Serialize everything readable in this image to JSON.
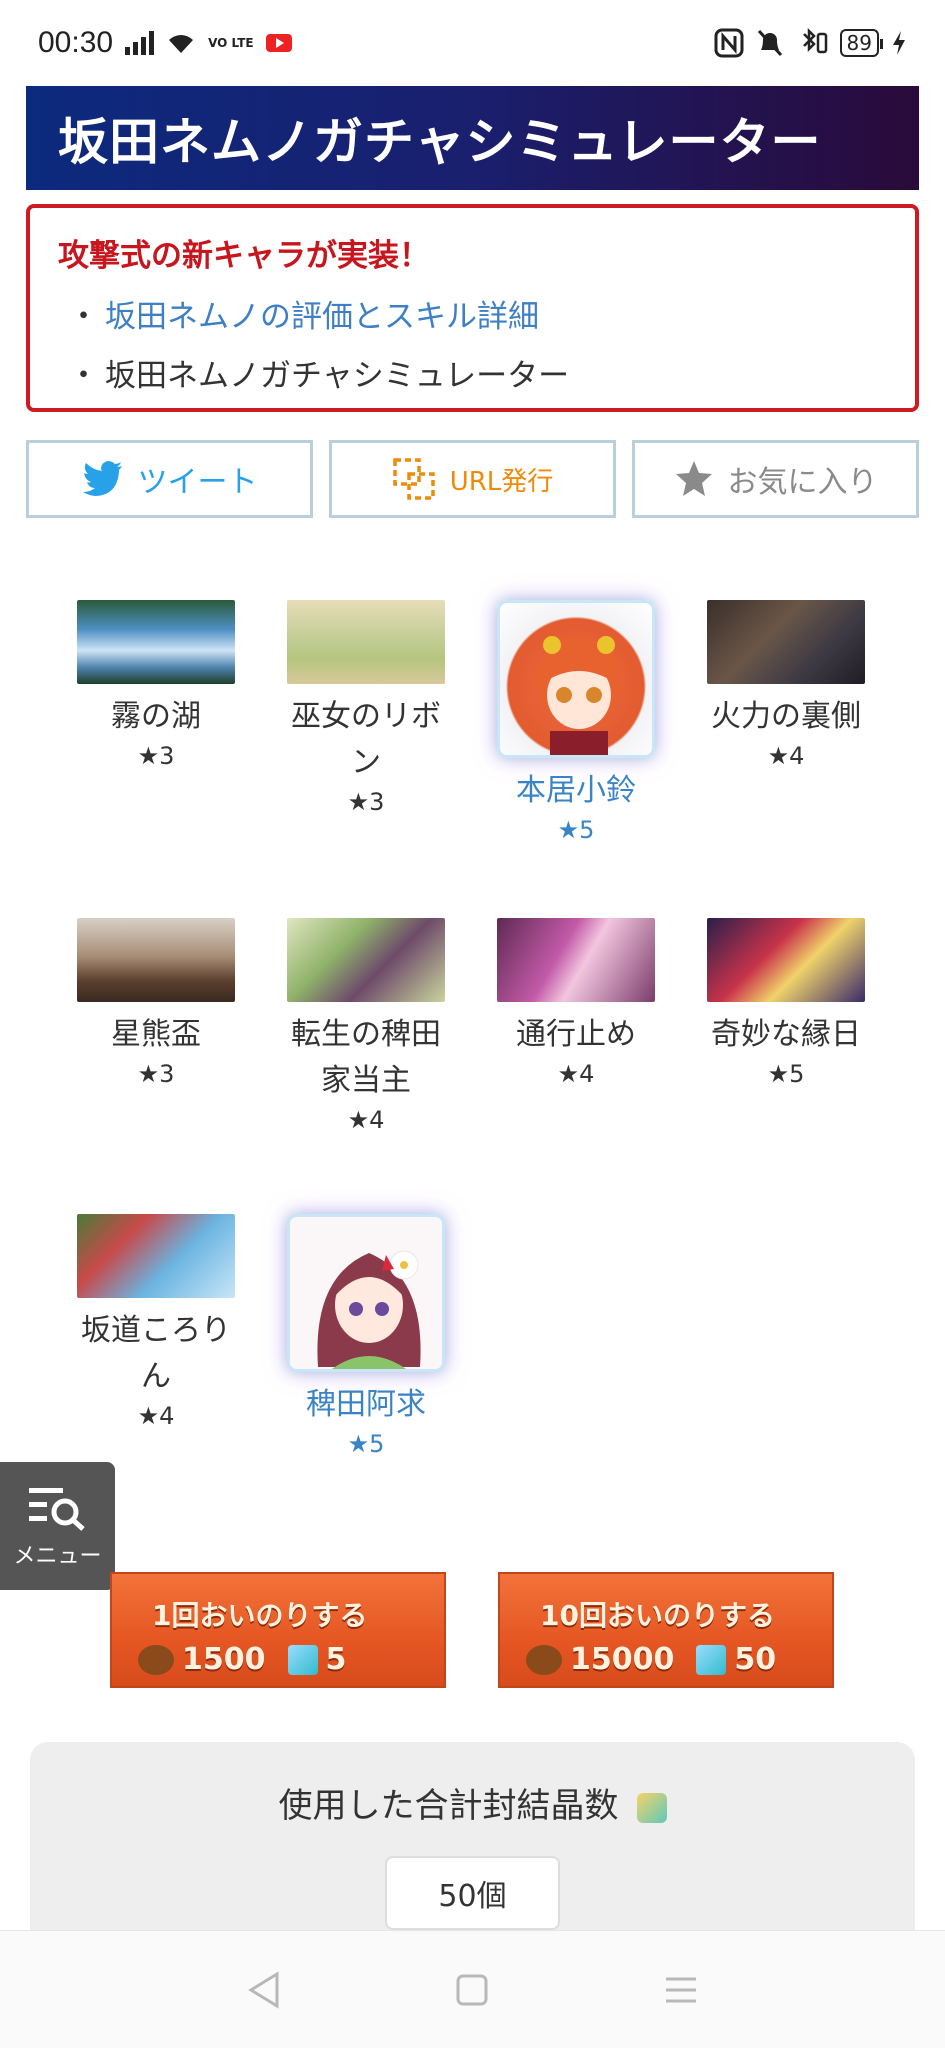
{
  "status_bar": {
    "time": "00:30",
    "network": "VO LTE",
    "battery": "89"
  },
  "header": {
    "title": "坂田ネムノガチャシミュレーター"
  },
  "notice": {
    "title": "攻撃式の新キャラが実装！",
    "items": [
      {
        "text": "坂田ネムノの評価とスキル詳細",
        "type": "link"
      },
      {
        "text": "坂田ネムノガチャシミュレーター",
        "type": "plain"
      }
    ]
  },
  "actions": {
    "tweet": "ツイート",
    "url": "URL発行",
    "favorite": "お気に入り"
  },
  "gacha_results": [
    {
      "name": "霧の湖",
      "stars": "★3",
      "rare": false
    },
    {
      "name": "巫女のリボン",
      "stars": "★3",
      "rare": false
    },
    {
      "name": "本居小鈴",
      "stars": "★5",
      "rare": true
    },
    {
      "name": "火力の裏側",
      "stars": "★4",
      "rare": false
    },
    {
      "name": "星熊盃",
      "stars": "★3",
      "rare": false
    },
    {
      "name": "転生の稗田家当主",
      "stars": "★4",
      "rare": false
    },
    {
      "name": "通行止め",
      "stars": "★4",
      "rare": false
    },
    {
      "name": "奇妙な縁日",
      "stars": "★5",
      "rare": false
    },
    {
      "name": "坂道ころりん",
      "stars": "★4",
      "rare": false
    },
    {
      "name": "稗田阿求",
      "stars": "★5",
      "rare": true
    }
  ],
  "menu": {
    "label": "メニュー"
  },
  "gacha_buttons": [
    {
      "label": "1回おいのりする",
      "coin": "1500",
      "crystal": "5"
    },
    {
      "label": "10回おいのりする",
      "coin": "15000",
      "crystal": "50"
    }
  ],
  "total": {
    "title": "使用した合計封結晶数",
    "value": "50個"
  },
  "colors": {
    "header_start": "#0c2a7e",
    "header_end": "#2a0a3a",
    "notice_border": "#d01a22",
    "link": "#3e7fc5",
    "rare": "#3a84c6",
    "tweet": "#27a1e8",
    "url": "#f08a0a",
    "gacha_button": "#e55623"
  }
}
